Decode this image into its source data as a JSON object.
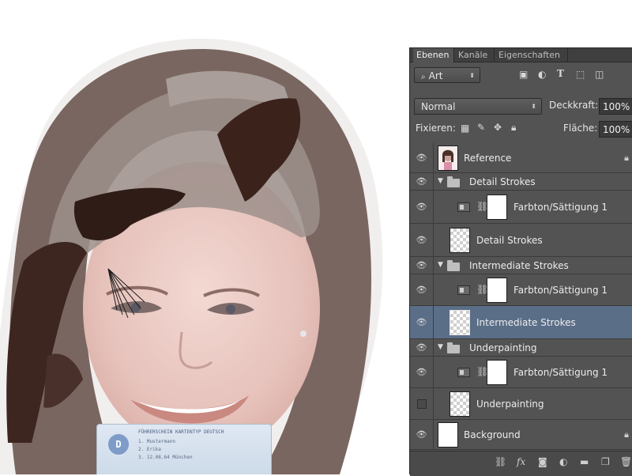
{
  "canvas": {
    "license": {
      "title": "FÜHRERSCHEIN  KARTENTYP DEUTSCH",
      "logo_letter": "D",
      "line1": "1. Mustermann",
      "line2": "2. Erika",
      "line3": "3. 12.08.64  München"
    }
  },
  "panel": {
    "tabs": [
      "Ebenen",
      "Kanäle",
      "Eigenschaften"
    ],
    "active_tab": "Ebenen",
    "filter_type": "Art",
    "filter_icons": [
      "image-filter-icon",
      "adjustment-filter-icon",
      "type-filter-icon",
      "shape-filter-icon",
      "smart-object-filter-icon"
    ],
    "blend_mode": "Normal",
    "opacity_label": "Deckkraft:",
    "opacity_value": "100%",
    "lock_label": "Fixieren:",
    "fill_label": "Fläche:",
    "fill_value": "100%",
    "layers": [
      {
        "name": "Reference",
        "kind": "image",
        "visible": true,
        "locked": true,
        "selected": false
      },
      {
        "name": "Detail Strokes",
        "kind": "group",
        "visible": true,
        "locked": false,
        "selected": false
      },
      {
        "name": "Farbton/Sättigung 1",
        "kind": "adjustment",
        "visible": true,
        "locked": false,
        "selected": false
      },
      {
        "name": "Detail Strokes",
        "kind": "pixel",
        "visible": true,
        "locked": false,
        "selected": false
      },
      {
        "name": "Intermediate Strokes",
        "kind": "group",
        "visible": true,
        "locked": false,
        "selected": false
      },
      {
        "name": "Farbton/Sättigung 1",
        "kind": "adjustment",
        "visible": true,
        "locked": false,
        "selected": false
      },
      {
        "name": "Intermediate Strokes",
        "kind": "pixel",
        "visible": true,
        "locked": false,
        "selected": true
      },
      {
        "name": "Underpainting",
        "kind": "group",
        "visible": true,
        "locked": false,
        "selected": false
      },
      {
        "name": "Farbton/Sättigung 1",
        "kind": "adjustment",
        "visible": true,
        "locked": false,
        "selected": false
      },
      {
        "name": "Underpainting",
        "kind": "pixel",
        "visible": false,
        "locked": false,
        "selected": false
      },
      {
        "name": "Background",
        "kind": "background",
        "visible": true,
        "locked": true,
        "selected": false
      }
    ],
    "bottom_icons": [
      "link-layers-icon",
      "fx-icon",
      "add-mask-icon",
      "adjustment-layer-icon",
      "new-group-icon",
      "new-layer-icon",
      "trash-icon"
    ]
  }
}
